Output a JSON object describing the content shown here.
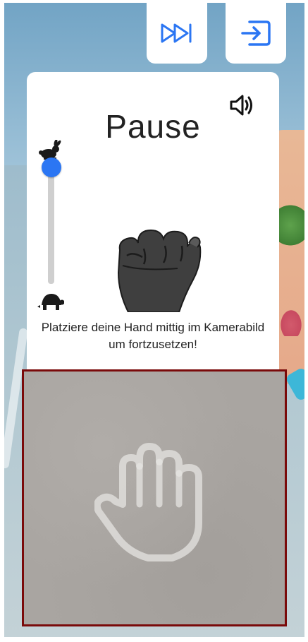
{
  "pause_panel": {
    "title": "Pause",
    "instruction": "Platziere deine Hand mittig im Kamerabild um fortzusetzen!",
    "speed_slider": {
      "level": 1.0,
      "top_icon": "rabbit-icon",
      "bottom_icon": "turtle-icon"
    },
    "sound_icon": "speaker-icon",
    "gesture_icon": "fist-icon"
  },
  "toolbar": {
    "skip_icon": "fast-forward-icon",
    "exit_icon": "exit-icon"
  },
  "camera": {
    "guide_icon": "open-hand-icon",
    "border_color": "#7a0a0a"
  },
  "colors": {
    "accent": "#2b76f3",
    "icon_blue": "#2b76f3"
  }
}
